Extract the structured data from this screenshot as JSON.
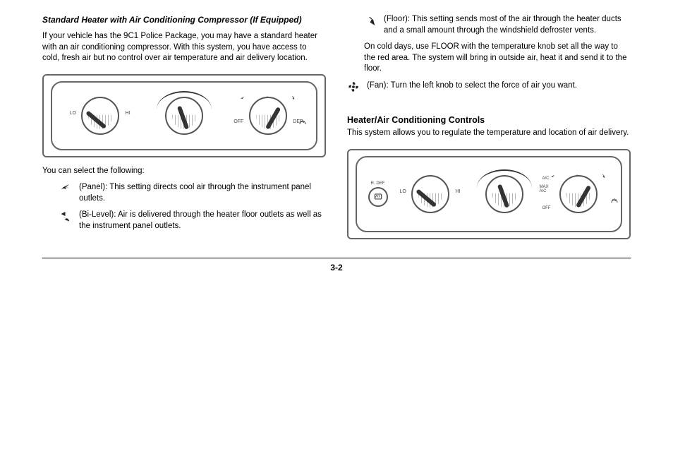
{
  "col_left": {
    "standard_heater_heading": "Standard Heater with Air Conditioning Compressor (If Equipped)",
    "standard_heater_intro": "If your vehicle has the 9C1 Police Package, you may have a standard heater with an air conditioning compressor. With this system, you have access to cold, fresh air but no control over air temperature and air delivery location.",
    "panel1": {
      "lo": "LO",
      "hi": "HI",
      "off": "OFF",
      "def": "DEF"
    },
    "select_following": "You can select the following:",
    "panel_item_icon": "panel-vent",
    "panel_item": "(Panel): This setting directs cool air through the instrument panel outlets.",
    "bi_level_item_icon": "bi-level",
    "bi_level_item": "(Bi-Level): Air is delivered through the heater floor outlets as well as the instrument panel outlets."
  },
  "col_right": {
    "floor_item_icon": "floor-vent",
    "floor_item": "(Floor): This setting sends most of the air through the heater ducts and a small amount through the windshield defroster vents.",
    "air_conditioning_note": "On cold days, use FLOOR with the temperature knob set all the way to the red area. The system will bring in outside air, heat it and send it to the floor.",
    "fan_heading_icon": "fan",
    "fan_heading": "(Fan): Turn the left knob to select the force of air you want.",
    "heater_ac_heading": "Heater/Air Conditioning Controls",
    "heater_ac_intro": "This system allows you to regulate the temperature and location of air delivery.",
    "panel2": {
      "rdef": "R. DEF",
      "lo": "LO",
      "hi": "HI",
      "ac": "A/C",
      "max": "MAX\nA/C",
      "off": "OFF"
    }
  },
  "page_number": "3-2"
}
